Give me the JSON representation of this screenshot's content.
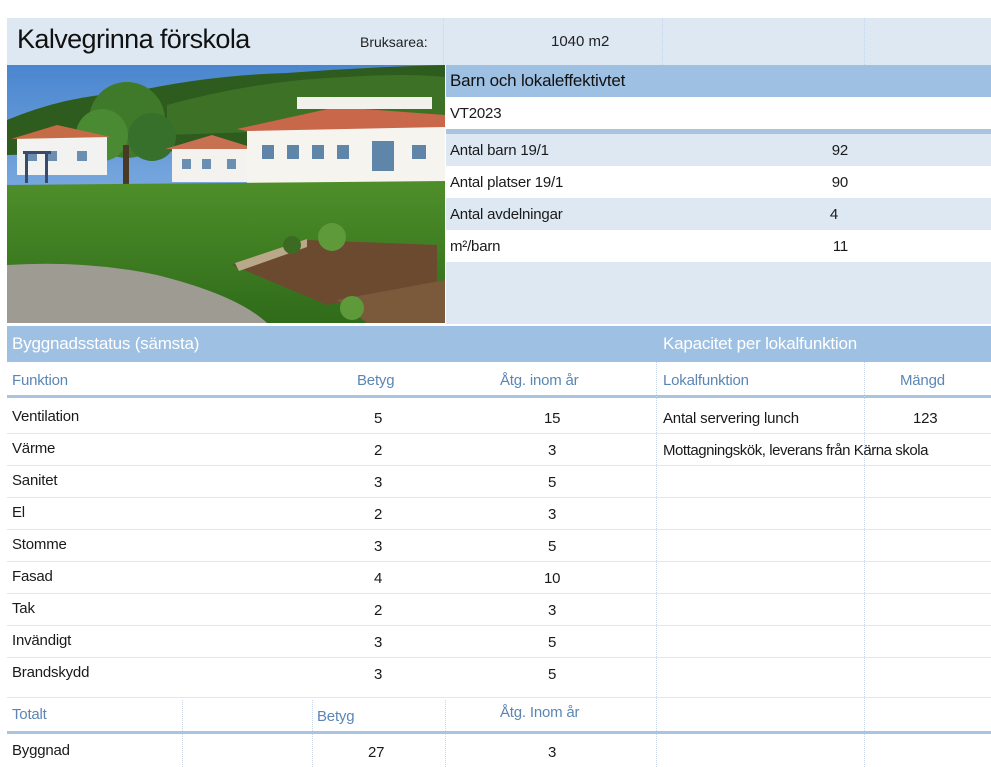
{
  "header": {
    "title": "Kalvegrinna förskola",
    "area_label": "Bruksarea:",
    "area_value": "1040 m2"
  },
  "stats": {
    "title": "Barn och lokaleffektivtet",
    "period": "VT2023",
    "rows": [
      {
        "label": "Antal barn 19/1",
        "value": "92"
      },
      {
        "label": "Antal platser 19/1",
        "value": "90"
      },
      {
        "label": "Antal avdelningar",
        "value": "4"
      },
      {
        "label": "m²/barn",
        "value": "11"
      }
    ]
  },
  "status": {
    "title": "Byggnadsstatus (sämsta)",
    "col_function": "Funktion",
    "col_grade": "Betyg",
    "col_years": "Åtg. inom år",
    "rows": [
      {
        "name": "Ventilation",
        "grade": "5",
        "years": "15"
      },
      {
        "name": "Värme",
        "grade": "2",
        "years": "3"
      },
      {
        "name": "Sanitet",
        "grade": "3",
        "years": "5"
      },
      {
        "name": "El",
        "grade": "2",
        "years": "3"
      },
      {
        "name": "Stomme",
        "grade": "3",
        "years": "5"
      },
      {
        "name": "Fasad",
        "grade": "4",
        "years": "10"
      },
      {
        "name": "Tak",
        "grade": "2",
        "years": "3"
      },
      {
        "name": "Invändigt",
        "grade": "3",
        "years": "5"
      },
      {
        "name": "Brandskydd",
        "grade": "3",
        "years": "5"
      }
    ],
    "total_label": "Totalt",
    "total_grade_head": "Betyg",
    "total_years_head": "Åtg. Inom år",
    "total_row": {
      "name": "Byggnad",
      "grade": "27",
      "years": "3"
    }
  },
  "capacity": {
    "title": "Kapacitet per lokalfunktion",
    "col_function": "Lokalfunktion",
    "col_amount": "Mängd",
    "rows": [
      {
        "name": "Antal servering lunch",
        "amount": "123"
      },
      {
        "name": "Mottagningskök, leverans från Kärna skola",
        "amount": ""
      }
    ]
  },
  "colors": {
    "header_band": "#9ec0e2",
    "light_band": "#dde8f3",
    "column_header_text": "#5b86b4"
  }
}
